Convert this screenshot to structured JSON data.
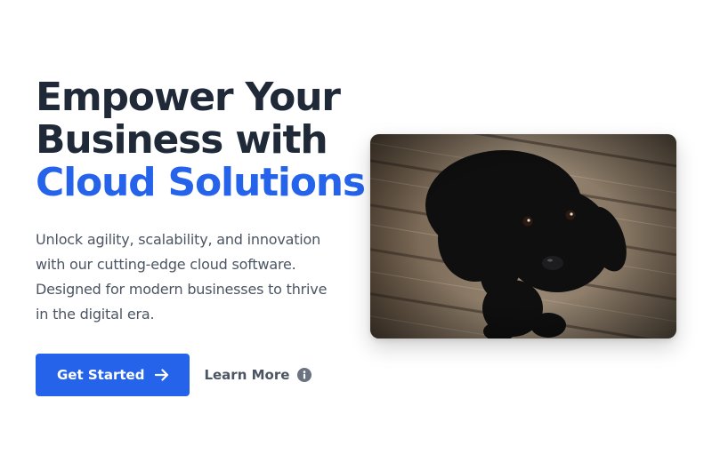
{
  "hero": {
    "headline_line1": "Empower Your",
    "headline_line2": "Business with",
    "headline_accent": "Cloud Solutions",
    "description": "Unlock agility, scalability, and innovation with our cutting-edge cloud software. Designed for modern businesses to thrive in the digital era.",
    "primary_button": {
      "label": "Get Started",
      "icon": "arrow-right-icon"
    },
    "secondary_button": {
      "label": "Learn More",
      "icon": "info-circle-icon"
    },
    "image": {
      "subject": "black-puppy-on-wooden-floor"
    }
  },
  "colors": {
    "heading": "#1f2937",
    "accent": "#2563eb",
    "body_text": "#4b5563",
    "button_bg": "#2563eb",
    "button_text": "#ffffff"
  }
}
